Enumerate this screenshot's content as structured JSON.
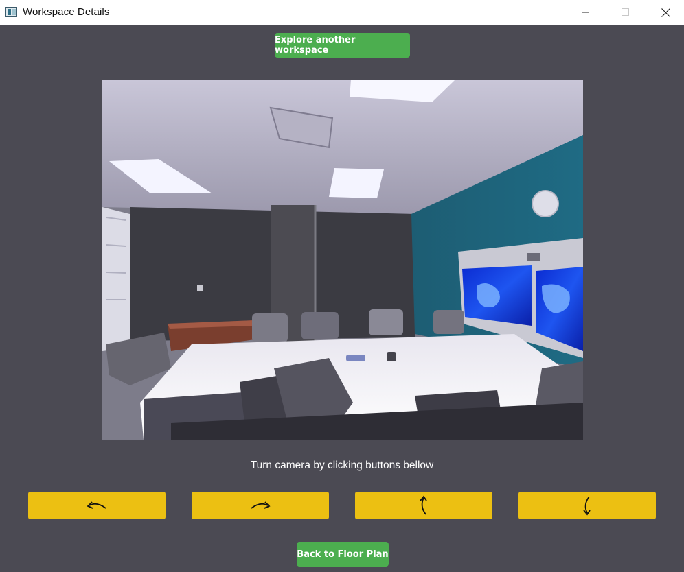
{
  "window": {
    "title": "Workspace Details",
    "icon": "app-window-icon",
    "controls": [
      "minimize-icon",
      "maximize-icon",
      "close-icon"
    ]
  },
  "actions": {
    "explore_label": "Explore another workspace",
    "back_label": "Back to Floor Plan"
  },
  "camera": {
    "image": "conference-room-3d-view",
    "instruction": "Turn camera by clicking buttons bellow"
  },
  "rotate_buttons": [
    {
      "icon": "rotate-left-arrow-icon"
    },
    {
      "icon": "rotate-right-arrow-icon"
    },
    {
      "icon": "rotate-up-arrow-icon"
    },
    {
      "icon": "rotate-down-arrow-icon"
    }
  ],
  "colors": {
    "background": "#4b4a53",
    "primary_button": "#4cae4f",
    "rotate_button": "#ecc012"
  }
}
